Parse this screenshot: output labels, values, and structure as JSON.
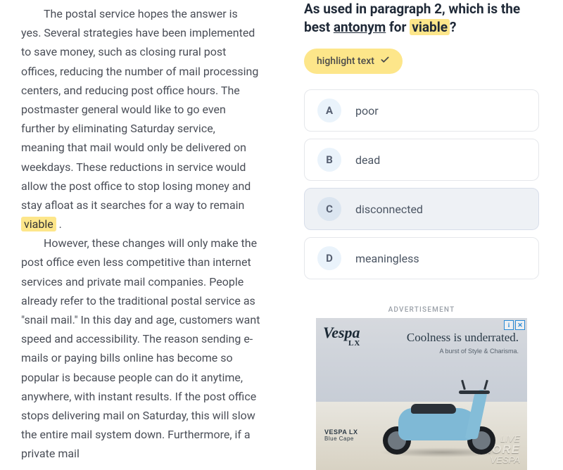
{
  "passage": {
    "p2_before": "The postal service hopes the answer is yes. Several strategies have been implemented to save money, such as closing rural post offices, reducing the number of mail processing centers, and reducing post office hours. The postmaster general would like to go even further by eliminating Saturday service, meaning that mail would only be delivered on weekdays. These reductions in service would allow the post office to stop losing money and stay afloat as it searches for a way to remain ",
    "p2_highlight": "viable",
    "p2_after": " .",
    "p3": "However, these changes will only make the post office even less competitive than internet services and private mail companies. People already refer to the traditional postal service as \"snail mail.\" In this day and age, customers want speed and accessibility. The reason sending e-mails or paying bills online has become so popular is because people can do it anytime, anywhere, with instant results. If the post office stops delivering mail on Saturday, this will slow the entire mail system down. Furthermore, if a private mail"
  },
  "question": {
    "prefix": "As used in paragraph 2, which is the best ",
    "underlined": "antonym",
    "mid": " for ",
    "highlighted": "viable",
    "suffix": "?"
  },
  "chip": {
    "label": "highlight text"
  },
  "choices": [
    {
      "letter": "A",
      "text": "poor",
      "selected": false
    },
    {
      "letter": "B",
      "text": "dead",
      "selected": false
    },
    {
      "letter": "C",
      "text": "disconnected",
      "selected": true
    },
    {
      "letter": "D",
      "text": "meaningless",
      "selected": false
    }
  ],
  "ad": {
    "label": "ADVERTISEMENT",
    "brand": "Vespa",
    "brand_sub": "LX",
    "headline": "Coolness is underrated.",
    "tagline": "A burst of Style & Charisma.",
    "model": "VESPA LX",
    "model_color": "Blue Cape",
    "stamp_top": "LIVE",
    "stamp_mid": "MORE",
    "stamp_bot": "VESPA",
    "info_glyph": "i",
    "close_glyph": "✕"
  }
}
